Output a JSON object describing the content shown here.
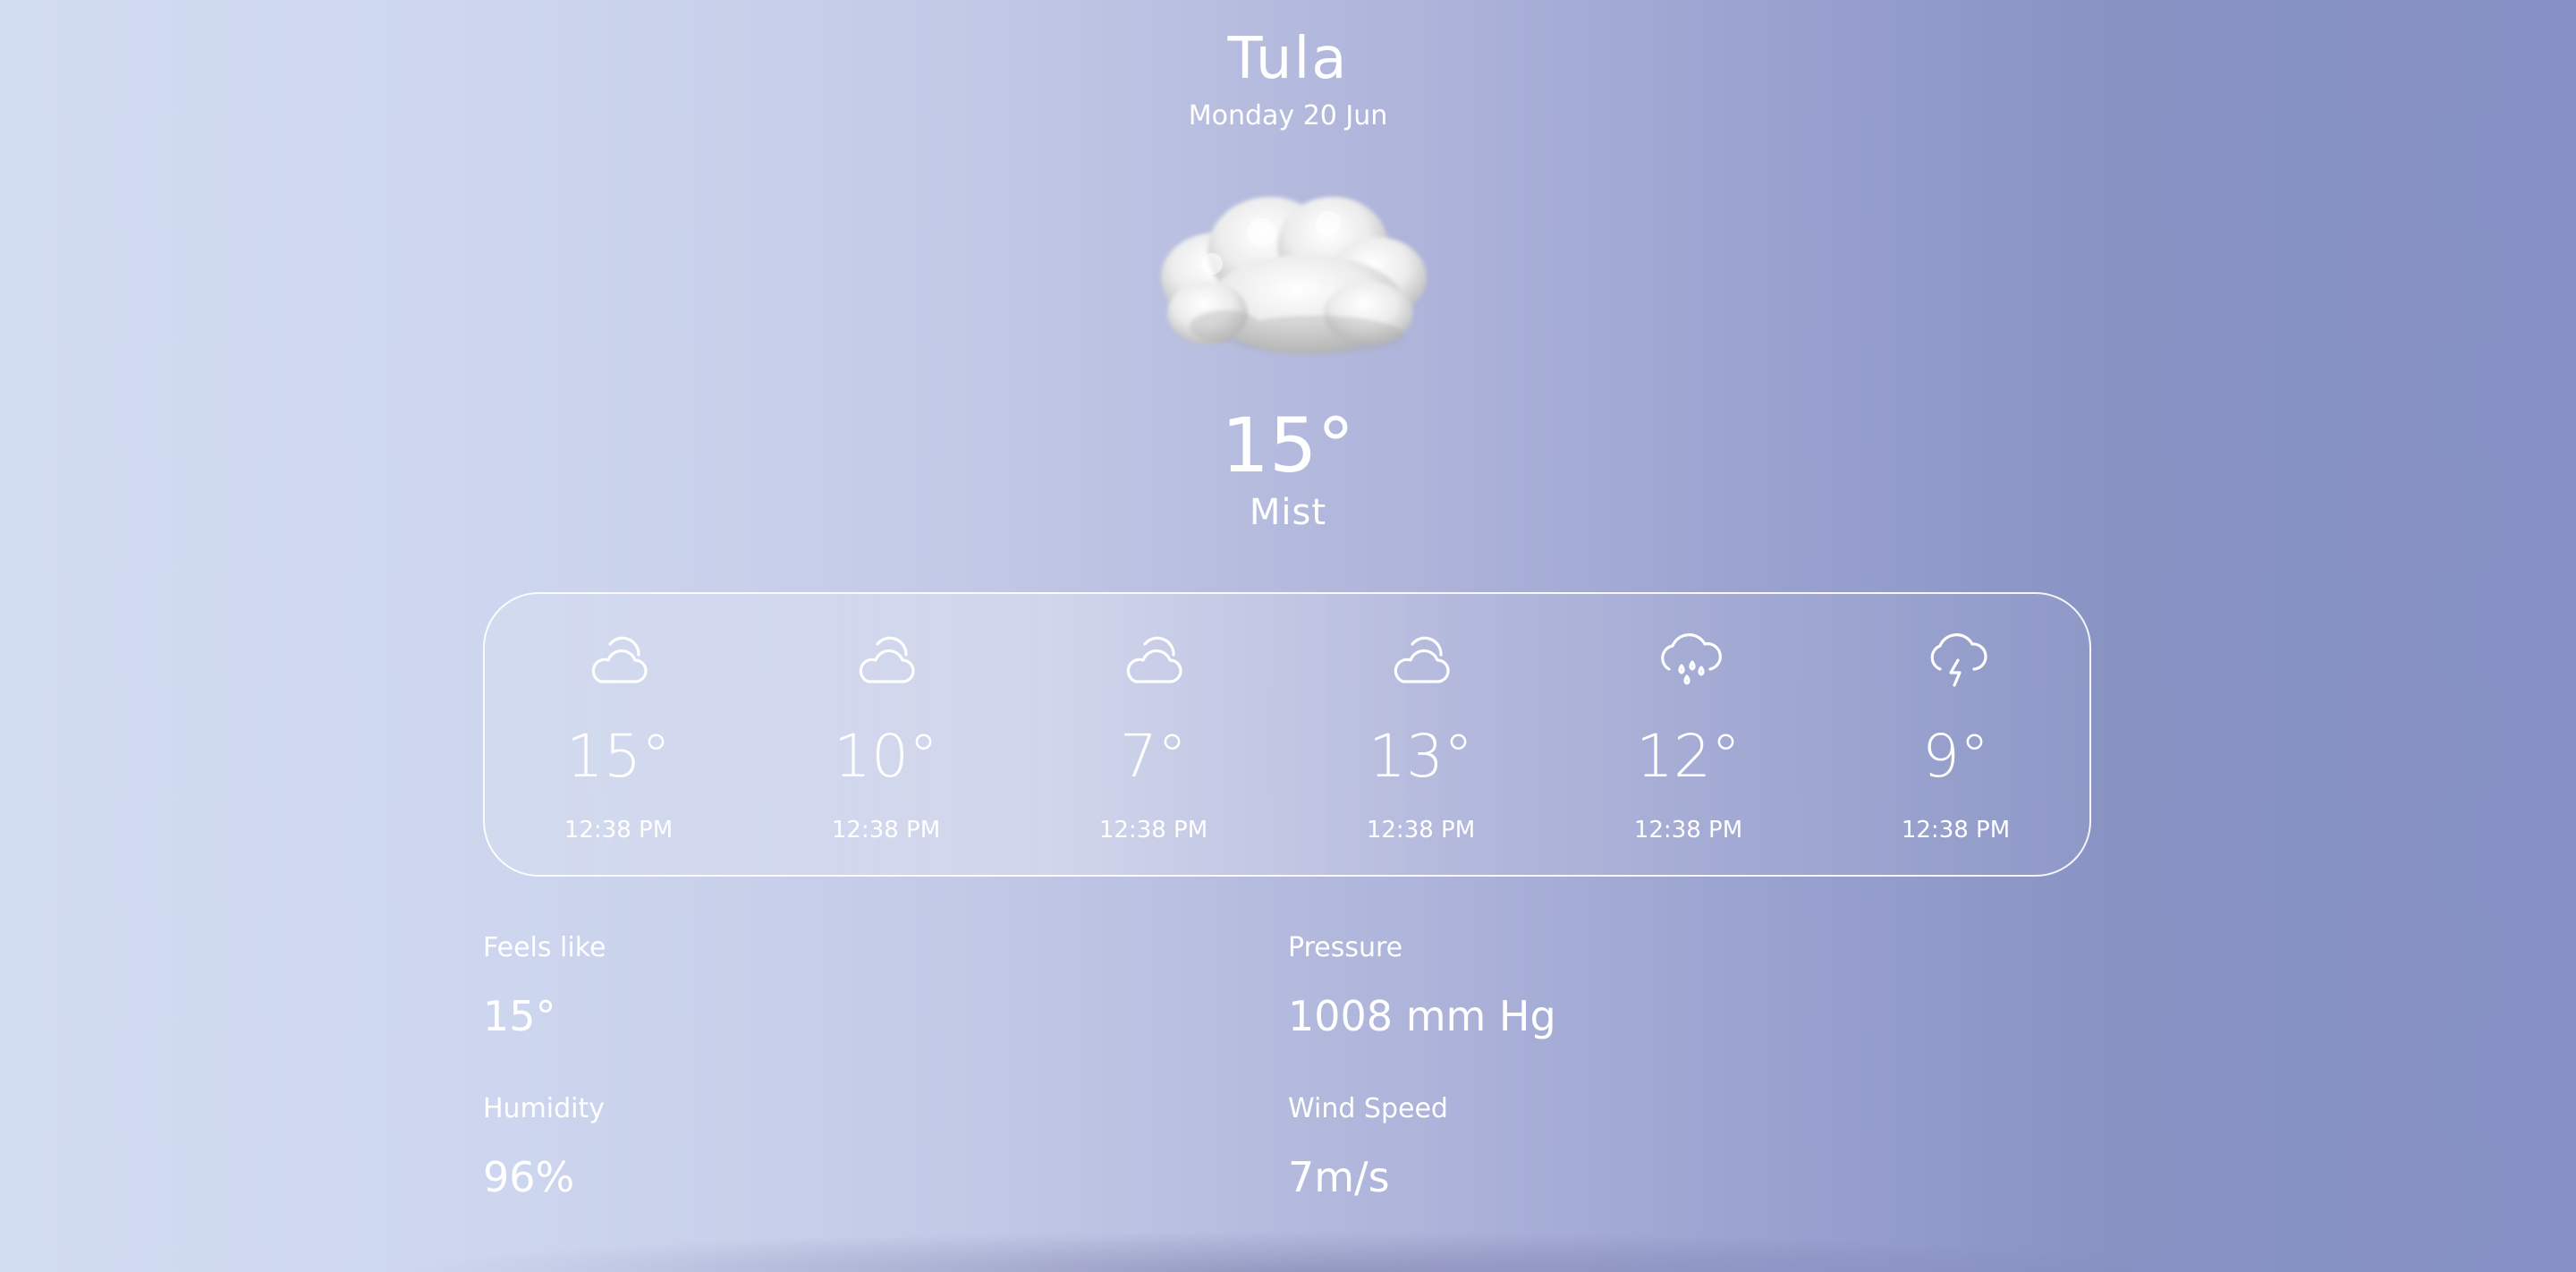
{
  "location": {
    "city": "Tula",
    "date": "Monday 20 Jun"
  },
  "current": {
    "icon": "cloud-icon",
    "temperature": "15°",
    "condition": "Mist"
  },
  "forecast": [
    {
      "icon": "partly-cloudy-icon",
      "temperature": "15°",
      "time": "12:38 PM"
    },
    {
      "icon": "partly-cloudy-icon",
      "temperature": "10°",
      "time": "12:38 PM"
    },
    {
      "icon": "partly-cloudy-icon",
      "temperature": "7°",
      "time": "12:38 PM"
    },
    {
      "icon": "partly-cloudy-icon",
      "temperature": "13°",
      "time": "12:38 PM"
    },
    {
      "icon": "rain-cloud-icon",
      "temperature": "12°",
      "time": "12:38 PM"
    },
    {
      "icon": "thunder-cloud-icon",
      "temperature": "9°",
      "time": "12:38 PM"
    }
  ],
  "details": {
    "feels_like": {
      "label": "Feels like",
      "value": "15°"
    },
    "pressure": {
      "label": "Pressure",
      "value": "1008 mm Hg"
    },
    "humidity": {
      "label": "Humidity",
      "value": "96%"
    },
    "wind_speed": {
      "label": "Wind Speed",
      "value": "7m/s"
    }
  },
  "colors": {
    "background_left": "#d2dcf0",
    "background_right": "#8690c4",
    "text": "#ffffff"
  }
}
